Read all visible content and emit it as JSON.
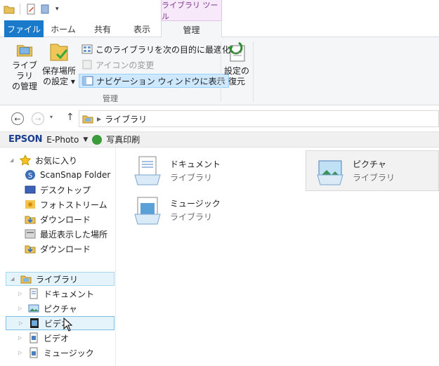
{
  "qat": {
    "icons": [
      "folder-icon",
      "properties-icon",
      "new-folder-icon"
    ],
    "customize": "▾"
  },
  "context_tab_group": "ライブラリ ツール",
  "tabs": {
    "file": "ファイル",
    "home": "ホーム",
    "share": "共有",
    "view": "表示",
    "manage": "管理"
  },
  "ribbon": {
    "manage_library": [
      "ライブラリ",
      "の管理"
    ],
    "save_location": [
      "保存場所",
      "の設定 ▾"
    ],
    "optimize": "このライブラリを次の目的に最適化 ▾",
    "change_icon": "アイコンの変更",
    "show_in_nav": "ナビゲーション ウィンドウに表示",
    "group_manage": "管理",
    "restore": [
      "設定の",
      "復元"
    ]
  },
  "address": {
    "crumb": "ライブラリ",
    "back": "←",
    "forward": "→",
    "up": "↑"
  },
  "epson": {
    "logo": "EPSON",
    "app": "E-Photo",
    "print": "写真印刷"
  },
  "nav": {
    "favorites_header": "お気に入り",
    "favorites": [
      "ScanSnap Folder",
      "デスクトップ",
      "フォトストリーム",
      "ダウンロード",
      "最近表示した場所",
      "ダウンロード"
    ],
    "libraries_header": "ライブラリ",
    "libraries": [
      "ドキュメント",
      "ピクチャ",
      "ビデオ",
      "ビデオ",
      "ミュージック"
    ]
  },
  "tiles": [
    {
      "name": "ドキュメント",
      "sub": "ライブラリ"
    },
    {
      "name": "ピクチャ",
      "sub": "ライブラリ"
    },
    {
      "name": "ミュージック",
      "sub": "ライブラリ"
    }
  ],
  "colors": {
    "file_tab": "#1979ca",
    "context": "#f7e8fa",
    "ribbon_bg": "#f5f6f7",
    "highlight": "#cde8ff"
  }
}
